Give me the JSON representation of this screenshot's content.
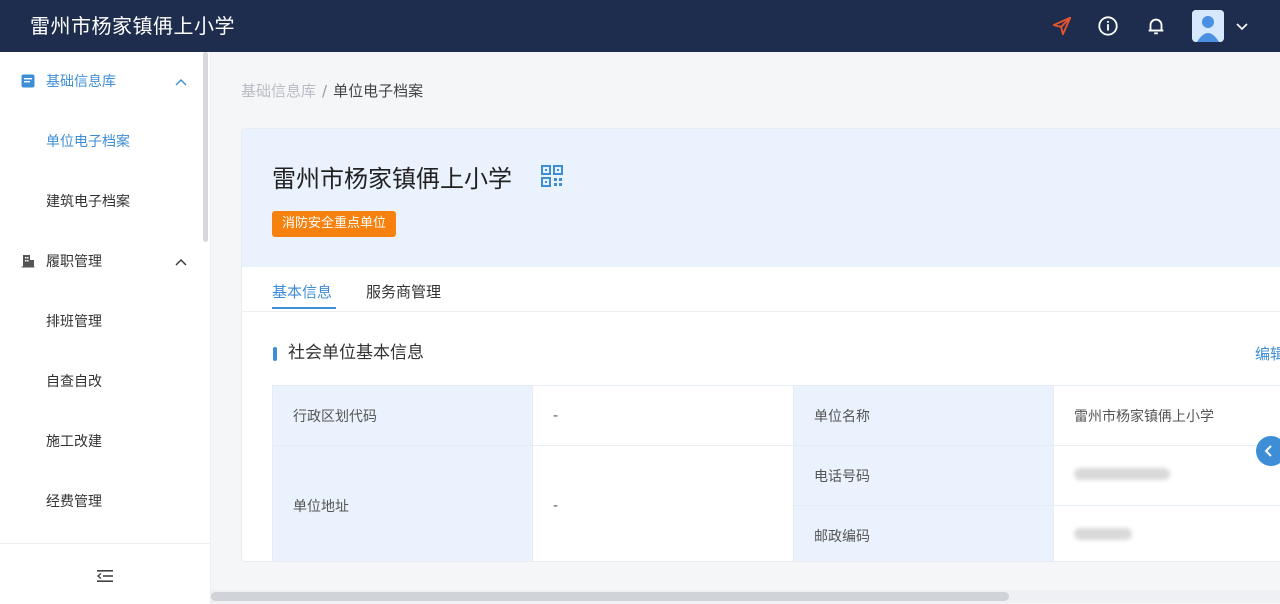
{
  "header": {
    "title": "雷州市杨家镇侢上小学",
    "icons": [
      "send-icon",
      "info-icon",
      "bell-icon",
      "avatar",
      "chevron-down-icon"
    ],
    "accent": "#e8542e"
  },
  "sidebar": {
    "groups": [
      {
        "label": "基础信息库",
        "icon": "document-icon",
        "expanded": true,
        "items": [
          "单位电子档案",
          "建筑电子档案"
        ]
      },
      {
        "label": "履职管理",
        "icon": "building-icon",
        "expanded": true,
        "items": [
          "排班管理",
          "自查自改",
          "施工改建",
          "经费管理"
        ]
      }
    ],
    "active_item": "单位电子档案",
    "collapse_icon": "menu-collapse-icon"
  },
  "breadcrumb": {
    "root": "基础信息库",
    "separator": "/",
    "current": "单位电子档案"
  },
  "unit": {
    "name": "雷州市杨家镇侢上小学",
    "badge": "消防安全重点单位",
    "qr_icon": "qrcode-icon"
  },
  "tabs": [
    "基本信息",
    "服务商管理"
  ],
  "active_tab": "基本信息",
  "section": {
    "title": "社会单位基本信息",
    "edit_label": "编辑"
  },
  "info": {
    "region_code_label": "行政区划代码",
    "region_code_value": "-",
    "unit_name_label": "单位名称",
    "unit_name_value": "雷州市杨家镇侢上小学",
    "address_label": "单位地址",
    "address_value": "-",
    "phone_label": "电话号码",
    "postcode_label": "邮政编码"
  },
  "colors": {
    "topbar": "#1e2d4d",
    "primary": "#3e8ed7",
    "badge": "#f7810e",
    "header_bg": "#eaf3fd"
  }
}
